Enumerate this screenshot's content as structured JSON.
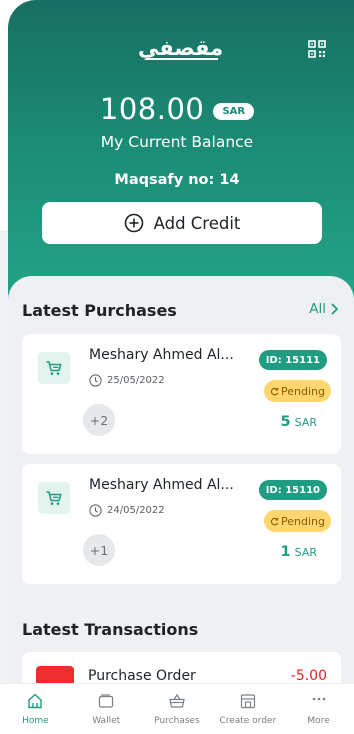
{
  "header": {
    "logo_text": "مقصفي",
    "qr_icon": "qr-code-icon"
  },
  "balance": {
    "amount": "108.00",
    "currency": "SAR",
    "label": "My Current Balance",
    "maqsafy_no": "Maqsafy no: 14",
    "add_credit_label": "Add Credit"
  },
  "purchases": {
    "title": "Latest Purchases",
    "see_all_label": "All",
    "items": [
      {
        "name": "Meshary Ahmed Al...",
        "date": "25/05/2022",
        "more": "+2",
        "id": "ID: 15111",
        "status": "Pending",
        "amount": "5",
        "currency": "SAR"
      },
      {
        "name": "Meshary Ahmed Al...",
        "date": "24/05/2022",
        "more": "+1",
        "id": "ID: 15110",
        "status": "Pending",
        "amount": "1",
        "currency": "SAR"
      }
    ]
  },
  "transactions": {
    "title": "Latest Transactions",
    "items": [
      {
        "title": "Purchase Order",
        "amount": "-5.00"
      }
    ]
  },
  "tabbar": {
    "items": [
      {
        "label": "Home",
        "icon": "home-icon",
        "active": true
      },
      {
        "label": "Wallet",
        "icon": "wallet-icon",
        "active": false
      },
      {
        "label": "Purchases",
        "icon": "basket-icon",
        "active": false
      },
      {
        "label": "Create order",
        "icon": "store-icon",
        "active": false
      },
      {
        "label": "More",
        "icon": "more-dots-icon",
        "active": false
      }
    ]
  },
  "colors": {
    "brand_green": "#1f9c82",
    "pending_yellow": "#ffd76e",
    "negative_red": "#e02424"
  }
}
